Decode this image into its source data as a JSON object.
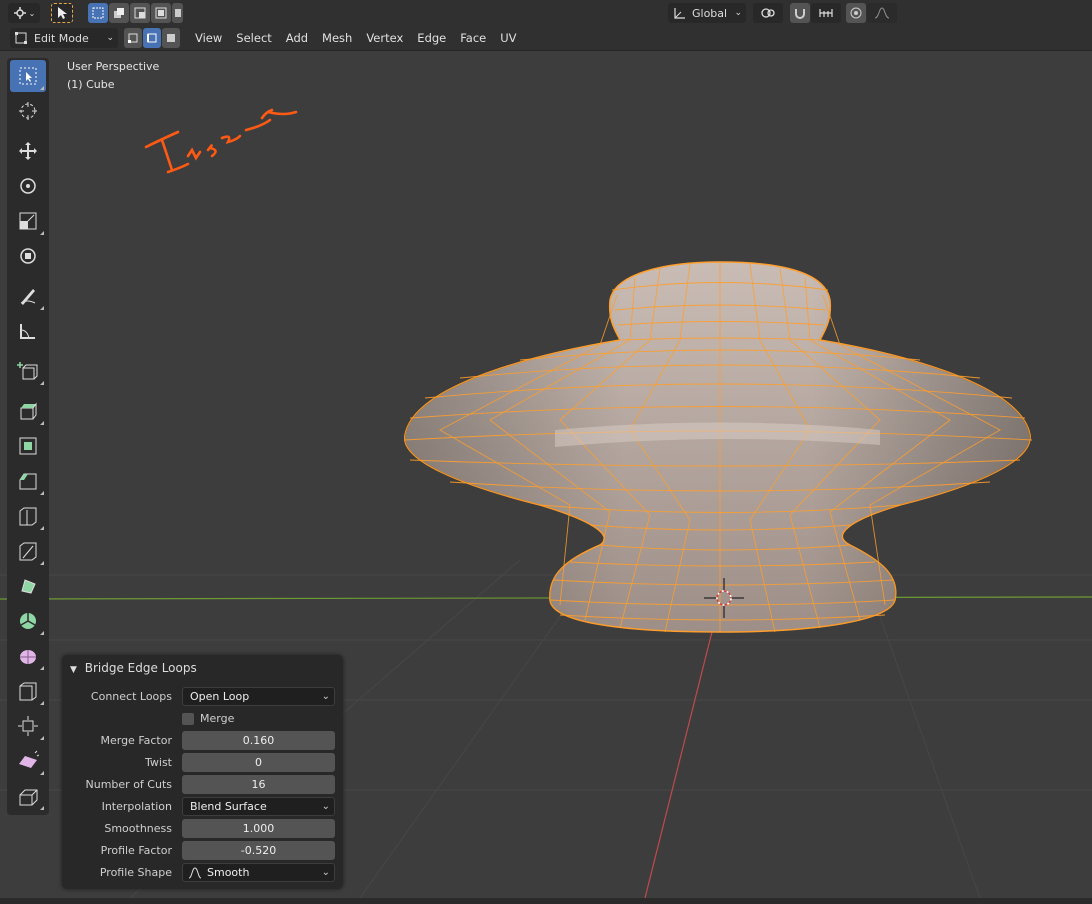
{
  "header": {
    "transform_orientation": "Global"
  },
  "edit_header": {
    "mode": "Edit Mode",
    "menus": [
      "View",
      "Select",
      "Add",
      "Mesh",
      "Vertex",
      "Edge",
      "Face",
      "UV"
    ]
  },
  "viewport": {
    "perspective_label": "User Perspective",
    "object_label": "(1) Cube",
    "annotation_text": "Insert",
    "colors": {
      "background": "#3d3d3d",
      "mesh_face": "#b8a9a1",
      "mesh_edge": "#ff9e2c",
      "annotation": "#ff5a14",
      "x_axis": "#c04a4a",
      "y_axis": "#6d9a35"
    }
  },
  "toolbar": {
    "tools": [
      "select-box-icon",
      "cursor-icon",
      "move-icon",
      "rotate-icon",
      "scale-icon",
      "transform-icon",
      "annotate-icon",
      "measure-icon",
      "add-cube-icon",
      "extrude-icon",
      "inset-icon",
      "bevel-icon",
      "loop-cut-icon",
      "knife-icon",
      "poly-build-icon",
      "spin-icon",
      "smooth-icon",
      "edge-slide-icon",
      "shrink-fatten-icon",
      "shear-icon",
      "rip-icon"
    ]
  },
  "operator_panel": {
    "title": "Bridge Edge Loops",
    "connect_loops_label": "Connect Loops",
    "connect_loops_value": "Open Loop",
    "merge_label": "Merge",
    "merge_factor_label": "Merge Factor",
    "merge_factor_value": "0.160",
    "twist_label": "Twist",
    "twist_value": "0",
    "number_of_cuts_label": "Number of Cuts",
    "number_of_cuts_value": "16",
    "interpolation_label": "Interpolation",
    "interpolation_value": "Blend Surface",
    "smoothness_label": "Smoothness",
    "smoothness_value": "1.000",
    "profile_factor_label": "Profile Factor",
    "profile_factor_value": "-0.520",
    "profile_shape_label": "Profile Shape",
    "profile_shape_value": "Smooth"
  }
}
